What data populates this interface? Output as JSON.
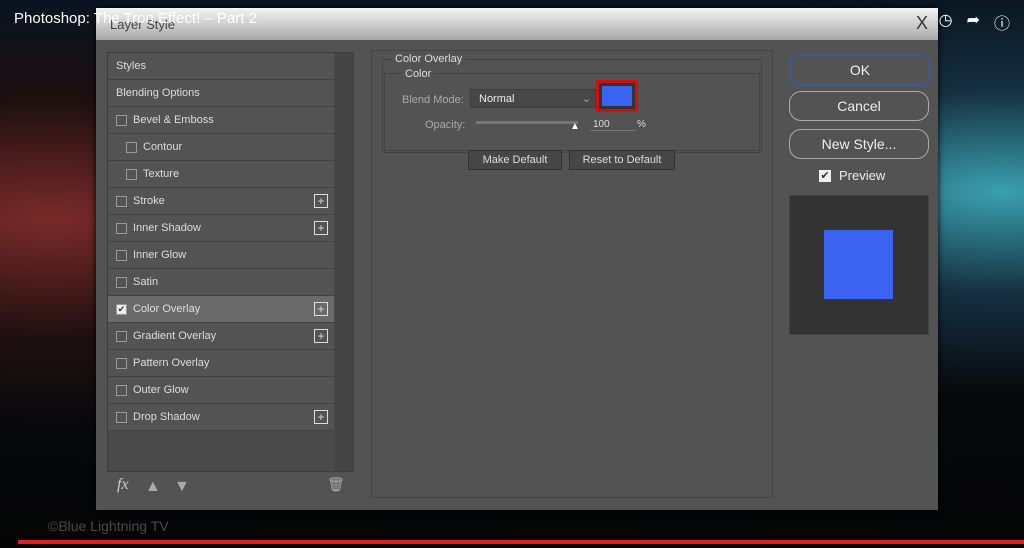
{
  "video": {
    "title": "Photoshop: The Tron Effect! – Part 2",
    "watermark": "©Blue Lightning TV",
    "progress_percent": 100,
    "icons": [
      "clock-icon",
      "share-icon",
      "info-icon"
    ]
  },
  "dialog": {
    "title": "Layer Style",
    "close": "X",
    "styles": [
      {
        "label": "Styles",
        "checkbox": false,
        "indent": 0,
        "plus": false,
        "checked": false
      },
      {
        "label": "Blending Options",
        "checkbox": false,
        "indent": 0,
        "plus": false,
        "checked": false
      },
      {
        "label": "Bevel & Emboss",
        "checkbox": true,
        "indent": 0,
        "plus": false,
        "checked": false
      },
      {
        "label": "Contour",
        "checkbox": true,
        "indent": 1,
        "plus": false,
        "checked": false
      },
      {
        "label": "Texture",
        "checkbox": true,
        "indent": 1,
        "plus": false,
        "checked": false
      },
      {
        "label": "Stroke",
        "checkbox": true,
        "indent": 0,
        "plus": true,
        "checked": false
      },
      {
        "label": "Inner Shadow",
        "checkbox": true,
        "indent": 0,
        "plus": true,
        "checked": false
      },
      {
        "label": "Inner Glow",
        "checkbox": true,
        "indent": 0,
        "plus": false,
        "checked": false
      },
      {
        "label": "Satin",
        "checkbox": true,
        "indent": 0,
        "plus": false,
        "checked": false
      },
      {
        "label": "Color Overlay",
        "checkbox": true,
        "indent": 0,
        "plus": true,
        "checked": true,
        "selected": true
      },
      {
        "label": "Gradient Overlay",
        "checkbox": true,
        "indent": 0,
        "plus": true,
        "checked": false
      },
      {
        "label": "Pattern Overlay",
        "checkbox": true,
        "indent": 0,
        "plus": false,
        "checked": false
      },
      {
        "label": "Outer Glow",
        "checkbox": true,
        "indent": 0,
        "plus": false,
        "checked": false
      },
      {
        "label": "Drop Shadow",
        "checkbox": true,
        "indent": 0,
        "plus": true,
        "checked": false
      }
    ],
    "footer": {
      "fx": "fx"
    },
    "panel": {
      "group": "Color Overlay",
      "subgroup": "Color",
      "blend_label": "Blend Mode:",
      "blend_value": "Normal",
      "opacity_label": "Opacity:",
      "opacity_value": "100",
      "opacity_unit": "%",
      "overlay_color": "#3a63f2",
      "make_default": "Make Default",
      "reset_default": "Reset to Default"
    },
    "buttons": {
      "ok": "OK",
      "cancel": "Cancel",
      "new_style": "New Style...",
      "preview": "Preview",
      "preview_checked": true
    }
  }
}
